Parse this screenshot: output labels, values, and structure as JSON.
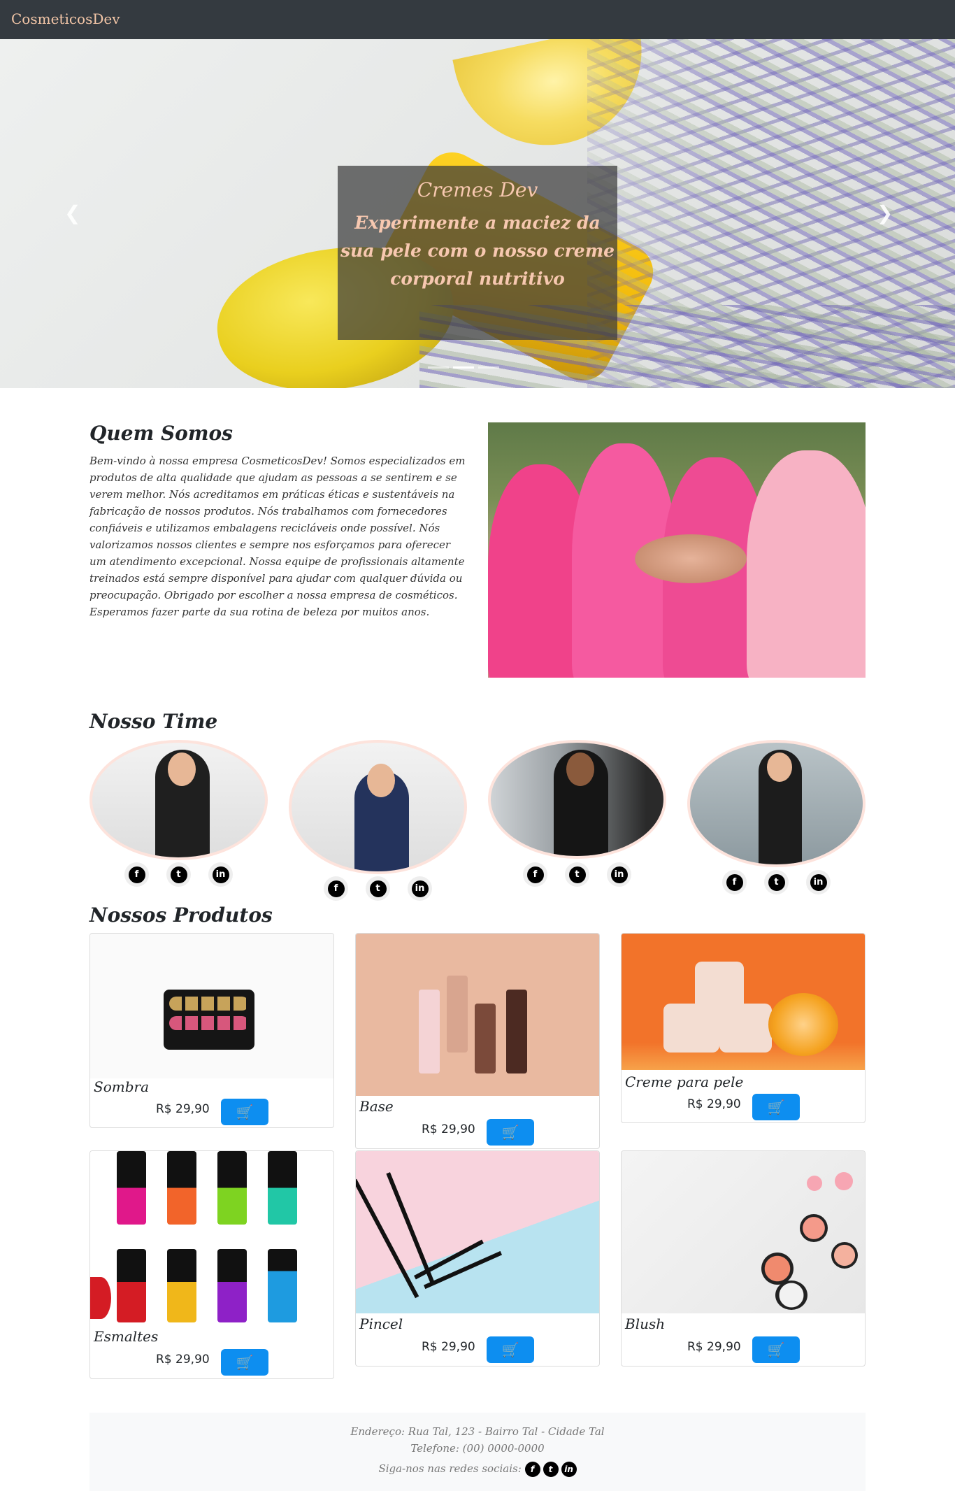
{
  "navbar": {
    "brand": "CosmeticosDev"
  },
  "carousel": {
    "title": "Cremes Dev",
    "text": "Experimente a maciez da sua pele com o nosso creme corporal nutritivo",
    "prev_icon": "chevron-left-icon",
    "next_icon": "chevron-right-icon",
    "indicator_count": 3,
    "active_indicator": 1
  },
  "about": {
    "title": "Quem Somos",
    "text": "Bem-vindo à nossa empresa CosmeticosDev! Somos especializados em produtos de alta qualidade que ajudam as pessoas a se sentirem e se verem melhor. Nós acreditamos em práticas éticas e sustentáveis na fabricação de nossos produtos. Nós trabalhamos com fornecedores confiáveis e utilizamos embalagens recicláveis onde possível. Nós valorizamos nossos clientes e sempre nos esforçamos para oferecer um atendimento excepcional. Nossa equipe de profissionais altamente treinados está sempre disponível para ajudar com qualquer dúvida ou preocupação. Obrigado por escolher a nossa empresa de cosméticos. Esperamos fazer parte da sua rotina de beleza por muitos anos."
  },
  "team": {
    "title": "Nosso Time",
    "members": [
      {
        "icons": [
          "facebook-icon",
          "twitter-icon",
          "linkedin-icon"
        ]
      },
      {
        "icons": [
          "facebook-icon",
          "twitter-icon",
          "linkedin-icon"
        ]
      },
      {
        "icons": [
          "facebook-icon",
          "twitter-icon",
          "linkedin-icon"
        ]
      },
      {
        "icons": [
          "facebook-icon",
          "twitter-icon",
          "linkedin-icon"
        ]
      }
    ]
  },
  "products": {
    "title": "Nossos Produtos",
    "items": [
      {
        "name": "Sombra",
        "price": "R$ 29,90",
        "cart_icon": "cart-icon"
      },
      {
        "name": "Base",
        "price": "R$ 29,90",
        "cart_icon": "cart-icon"
      },
      {
        "name": "Creme para pele",
        "price": "R$ 29,90",
        "cart_icon": "cart-icon"
      },
      {
        "name": "Esmaltes",
        "price": "R$ 29,90",
        "cart_icon": "cart-icon"
      },
      {
        "name": "Pincel",
        "price": "R$ 29,90",
        "cart_icon": "cart-icon"
      },
      {
        "name": "Blush",
        "price": "R$ 29,90",
        "cart_icon": "cart-icon"
      }
    ]
  },
  "footer": {
    "address": "Endereço: Rua Tal, 123 - Bairro Tal - Cidade Tal",
    "phone": "Telefone: (00) 0000-0000",
    "social_label": "Siga-nos nas redes sociais:"
  },
  "colors": {
    "navbar_bg": "#343a40",
    "brand": "#f4c7a8",
    "cart_button": "#0d8ef0",
    "footer_bg": "#f8f9fa"
  }
}
